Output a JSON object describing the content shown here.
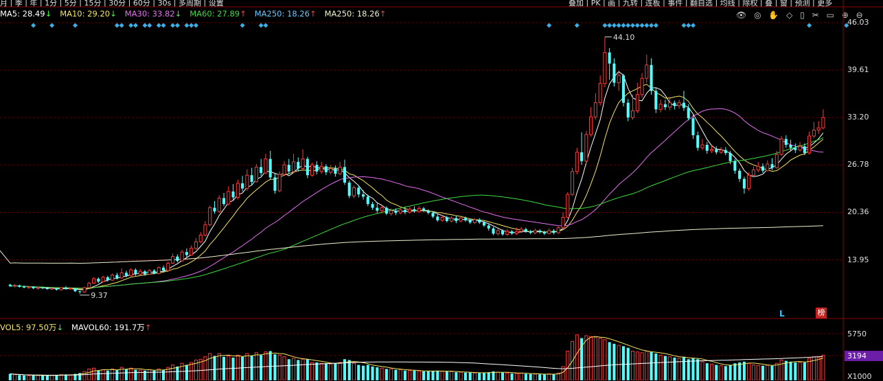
{
  "toolbar": {
    "left_items": [
      "月",
      "季",
      "年",
      "1分",
      "5分",
      "15分",
      "30分",
      "60分",
      "30s",
      "多周期",
      "设置"
    ],
    "right_items": [
      "叠加",
      "PK",
      "画",
      "九转",
      "连板",
      "事件",
      "翻自选",
      "均线",
      "除权",
      "叠",
      "窗",
      "预测",
      "更多"
    ]
  },
  "ma_legend": [
    {
      "label": "MA5: 28.49",
      "arrow": "↓",
      "color": "#ffffff"
    },
    {
      "label": "MA10: 29.20",
      "arrow": "↓",
      "color": "#f5e663"
    },
    {
      "label": "MA30: 33.82",
      "arrow": "↓",
      "color": "#e46ff0"
    },
    {
      "label": "MA60: 27.89",
      "arrow": "↑",
      "color": "#3ddc3d"
    },
    {
      "label": "MA250: 18.26",
      "arrow": "↑",
      "color": "#6cc6ff"
    },
    {
      "label": "MA250: 18.26",
      "arrow": "↑",
      "color": "#f0f0d0"
    }
  ],
  "vol_legend": [
    {
      "label": "VOL5: 97.50万",
      "arrow": "↓",
      "color": "#f5e663"
    },
    {
      "label": "MAVOL60: 191.7万",
      "arrow": "↑",
      "color": "#ffffff"
    }
  ],
  "annotations": {
    "high_label": "44.10",
    "low_label": "9.37",
    "marker_l": "L",
    "marker_bang": "榜"
  },
  "volume_axis": {
    "ticks": [
      "5750",
      "3194",
      "X1000"
    ]
  },
  "colors": {
    "up": "#ff3b3b",
    "down": "#54ffff",
    "grid": "#5a0000",
    "axis_text": "#e0e0e0"
  },
  "chart_data": {
    "type": "candlestick",
    "price_axis": {
      "ticks": [
        46.03,
        39.61,
        33.2,
        26.78,
        20.36,
        13.95
      ],
      "ylim": [
        7.5,
        46.03
      ]
    },
    "volume_axis": {
      "ylim": [
        0,
        5750
      ]
    },
    "candles": [
      [
        10.6,
        10.4,
        10.7,
        10.3,
        800
      ],
      [
        10.4,
        10.5,
        10.7,
        10.2,
        700
      ],
      [
        10.5,
        10.3,
        10.6,
        10.2,
        650
      ],
      [
        10.3,
        10.2,
        10.5,
        10.1,
        600
      ],
      [
        10.2,
        10.3,
        10.4,
        10.0,
        580
      ],
      [
        10.3,
        10.1,
        10.4,
        10.0,
        620
      ],
      [
        10.1,
        10.2,
        10.3,
        9.9,
        600
      ],
      [
        10.2,
        10.1,
        10.3,
        10.0,
        590
      ],
      [
        10.1,
        10.0,
        10.3,
        9.9,
        600
      ],
      [
        10.0,
        10.1,
        10.2,
        9.9,
        610
      ],
      [
        10.1,
        9.9,
        10.2,
        9.8,
        640
      ],
      [
        9.9,
        10.2,
        10.3,
        9.8,
        700
      ],
      [
        10.2,
        10.0,
        10.4,
        9.9,
        720
      ],
      [
        10.0,
        10.1,
        10.2,
        9.9,
        650
      ],
      [
        10.1,
        9.7,
        10.2,
        9.6,
        800
      ],
      [
        9.7,
        9.6,
        9.8,
        9.37,
        900
      ],
      [
        9.6,
        10.2,
        10.3,
        9.5,
        1100
      ],
      [
        10.2,
        10.8,
        11.0,
        10.1,
        1400
      ],
      [
        10.8,
        11.4,
        11.6,
        10.7,
        1500
      ],
      [
        11.4,
        11.0,
        11.6,
        10.8,
        1200
      ],
      [
        11.0,
        11.6,
        11.8,
        10.9,
        1300
      ],
      [
        11.6,
        11.2,
        11.8,
        11.0,
        1200
      ],
      [
        11.2,
        11.9,
        12.1,
        11.1,
        1400
      ],
      [
        11.9,
        11.5,
        12.2,
        11.3,
        1300
      ],
      [
        11.5,
        12.2,
        12.8,
        11.4,
        1600
      ],
      [
        12.2,
        11.8,
        12.5,
        11.6,
        1400
      ],
      [
        11.8,
        12.6,
        12.8,
        11.7,
        1500
      ],
      [
        12.6,
        12.0,
        12.8,
        11.8,
        1300
      ],
      [
        12.0,
        12.4,
        12.7,
        11.9,
        1250
      ],
      [
        12.4,
        12.0,
        12.6,
        11.8,
        1200
      ],
      [
        12.0,
        12.5,
        12.7,
        11.9,
        1300
      ],
      [
        12.5,
        12.1,
        12.7,
        12.0,
        1200
      ],
      [
        12.1,
        12.9,
        13.1,
        12.0,
        1400
      ],
      [
        12.9,
        12.5,
        13.2,
        12.3,
        1300
      ],
      [
        12.5,
        13.5,
        13.7,
        12.4,
        1600
      ],
      [
        13.5,
        14.4,
        14.8,
        13.4,
        1900
      ],
      [
        14.4,
        13.8,
        14.7,
        13.6,
        1700
      ],
      [
        13.8,
        15.0,
        15.3,
        13.7,
        2100
      ],
      [
        15.0,
        14.6,
        15.5,
        14.3,
        1900
      ],
      [
        14.6,
        15.5,
        15.9,
        14.5,
        2200
      ],
      [
        15.5,
        16.4,
        16.9,
        15.3,
        2500
      ],
      [
        16.4,
        17.3,
        17.7,
        16.2,
        2600
      ],
      [
        17.3,
        18.7,
        19.2,
        17.1,
        2900
      ],
      [
        18.7,
        21.0,
        21.3,
        18.5,
        3300
      ],
      [
        21.0,
        20.5,
        21.9,
        20.2,
        3000
      ],
      [
        20.5,
        22.3,
        22.7,
        20.3,
        3300
      ],
      [
        22.3,
        21.5,
        23.0,
        21.2,
        2900
      ],
      [
        21.5,
        23.2,
        23.9,
        21.3,
        3000
      ],
      [
        23.2,
        22.4,
        24.2,
        22.0,
        2800
      ],
      [
        22.4,
        24.3,
        24.8,
        22.1,
        3100
      ],
      [
        24.3,
        23.6,
        25.3,
        23.2,
        2900
      ],
      [
        23.6,
        25.4,
        26.2,
        23.3,
        3300
      ],
      [
        25.4,
        24.5,
        26.4,
        24.1,
        3000
      ],
      [
        24.5,
        26.5,
        26.9,
        24.4,
        3400
      ],
      [
        26.5,
        25.7,
        27.6,
        25.3,
        3100
      ],
      [
        25.7,
        27.6,
        28.3,
        25.5,
        3500
      ],
      [
        27.6,
        25.1,
        28.7,
        24.8,
        3600
      ],
      [
        25.1,
        23.3,
        25.6,
        22.9,
        3200
      ],
      [
        23.3,
        25.5,
        25.9,
        23.1,
        3100
      ],
      [
        25.5,
        26.8,
        27.3,
        25.3,
        2900
      ],
      [
        26.8,
        25.9,
        27.6,
        25.5,
        2600
      ],
      [
        25.9,
        27.2,
        28.3,
        25.7,
        2700
      ],
      [
        27.2,
        26.3,
        27.8,
        25.9,
        2500
      ],
      [
        26.3,
        27.6,
        28.9,
        26.1,
        2600
      ],
      [
        27.6,
        25.4,
        27.9,
        25.0,
        2600
      ],
      [
        25.4,
        26.8,
        27.1,
        25.2,
        2200
      ],
      [
        26.8,
        25.9,
        27.3,
        25.5,
        2200
      ],
      [
        25.9,
        26.6,
        27.2,
        25.6,
        2100
      ],
      [
        26.6,
        25.8,
        26.9,
        25.4,
        2100
      ],
      [
        25.8,
        26.3,
        26.8,
        25.5,
        2000
      ],
      [
        26.3,
        25.6,
        26.7,
        25.2,
        2100
      ],
      [
        25.6,
        26.5,
        27.2,
        25.4,
        2200
      ],
      [
        26.5,
        24.4,
        27.5,
        24.1,
        2600
      ],
      [
        24.4,
        22.6,
        24.7,
        22.3,
        2500
      ],
      [
        22.6,
        23.7,
        24.0,
        22.3,
        2100
      ],
      [
        23.7,
        22.8,
        24.0,
        22.4,
        1900
      ],
      [
        22.8,
        22.5,
        23.4,
        22.1,
        1800
      ],
      [
        22.5,
        21.5,
        22.8,
        21.2,
        1900
      ],
      [
        21.5,
        21.0,
        21.8,
        20.7,
        1700
      ],
      [
        21.0,
        20.6,
        21.6,
        20.3,
        1600
      ],
      [
        20.6,
        21.0,
        21.3,
        20.2,
        1500
      ],
      [
        21.0,
        20.2,
        21.2,
        20.0,
        1400
      ],
      [
        20.2,
        20.6,
        20.9,
        19.9,
        1400
      ],
      [
        20.6,
        20.3,
        20.9,
        20.0,
        1300
      ],
      [
        20.3,
        20.7,
        21.0,
        20.1,
        1300
      ],
      [
        20.7,
        20.4,
        21.1,
        20.1,
        1200
      ],
      [
        20.4,
        20.8,
        21.1,
        20.2,
        1200
      ],
      [
        20.8,
        20.5,
        21.2,
        20.3,
        1200
      ],
      [
        20.5,
        20.9,
        21.2,
        20.3,
        1150
      ],
      [
        20.9,
        20.6,
        21.1,
        20.4,
        1100
      ],
      [
        20.6,
        20.3,
        20.8,
        20.1,
        1100
      ],
      [
        20.3,
        19.8,
        20.5,
        19.6,
        1150
      ],
      [
        19.8,
        19.3,
        20.1,
        19.1,
        1200
      ],
      [
        19.3,
        19.7,
        20.0,
        19.1,
        1100
      ],
      [
        19.7,
        19.2,
        19.9,
        19.0,
        1100
      ],
      [
        19.2,
        19.6,
        19.9,
        19.0,
        1050
      ],
      [
        19.6,
        19.2,
        19.9,
        18.9,
        1000
      ],
      [
        19.2,
        19.6,
        19.9,
        19.0,
        1000
      ],
      [
        19.6,
        19.3,
        19.8,
        19.1,
        950
      ],
      [
        19.3,
        19.0,
        19.5,
        18.8,
        950
      ],
      [
        19.0,
        19.4,
        19.6,
        18.8,
        900
      ],
      [
        19.4,
        19.0,
        19.6,
        18.8,
        900
      ],
      [
        19.0,
        18.6,
        19.2,
        18.4,
        950
      ],
      [
        18.6,
        18.2,
        18.9,
        17.9,
        1000
      ],
      [
        18.2,
        17.5,
        18.4,
        17.3,
        1100
      ],
      [
        17.5,
        17.9,
        18.2,
        17.2,
        1000
      ],
      [
        17.9,
        17.4,
        18.1,
        17.2,
        950
      ],
      [
        17.4,
        17.8,
        18.1,
        17.2,
        900
      ],
      [
        17.8,
        17.5,
        18.0,
        17.3,
        850
      ],
      [
        17.5,
        17.8,
        18.3,
        17.3,
        850
      ],
      [
        17.8,
        18.1,
        18.4,
        17.6,
        900
      ],
      [
        18.1,
        17.8,
        18.3,
        17.6,
        800
      ],
      [
        17.8,
        17.6,
        18.0,
        17.4,
        780
      ],
      [
        17.6,
        17.9,
        18.2,
        17.4,
        760
      ],
      [
        17.9,
        17.7,
        18.1,
        17.5,
        740
      ],
      [
        17.7,
        17.5,
        17.9,
        17.3,
        740
      ],
      [
        17.5,
        17.9,
        18.2,
        17.4,
        800
      ],
      [
        17.9,
        17.6,
        18.1,
        17.4,
        760
      ],
      [
        17.6,
        18.3,
        18.5,
        17.5,
        900
      ],
      [
        18.3,
        19.7,
        20.4,
        18.2,
        1700
      ],
      [
        19.7,
        22.8,
        23.1,
        19.6,
        3600
      ],
      [
        22.8,
        25.9,
        26.4,
        22.6,
        4800
      ],
      [
        25.9,
        28.5,
        29.1,
        25.5,
        5600
      ],
      [
        28.5,
        27.3,
        31.2,
        26.8,
        5200
      ],
      [
        27.3,
        30.9,
        31.4,
        27.0,
        5500
      ],
      [
        30.9,
        33.3,
        34.6,
        30.6,
        5400
      ],
      [
        33.3,
        35.2,
        36.5,
        32.9,
        5300
      ],
      [
        35.2,
        37.8,
        38.9,
        34.8,
        5200
      ],
      [
        37.8,
        42.0,
        44.1,
        37.3,
        5000
      ],
      [
        42.0,
        40.5,
        42.6,
        38.3,
        4700
      ],
      [
        40.5,
        37.9,
        41.2,
        37.4,
        4500
      ],
      [
        37.9,
        38.9,
        39.4,
        36.8,
        4300
      ],
      [
        38.9,
        35.2,
        39.1,
        34.7,
        4200
      ],
      [
        35.2,
        33.2,
        35.7,
        32.7,
        4000
      ],
      [
        33.2,
        34.1,
        36.3,
        32.9,
        3600
      ],
      [
        34.1,
        36.3,
        37.9,
        33.8,
        3500
      ],
      [
        36.3,
        38.5,
        39.2,
        35.9,
        3400
      ],
      [
        38.5,
        40.3,
        41.7,
        37.9,
        3600
      ],
      [
        40.3,
        36.8,
        41.2,
        36.3,
        3500
      ],
      [
        36.8,
        34.3,
        37.2,
        33.8,
        3300
      ],
      [
        34.3,
        35.0,
        35.6,
        33.9,
        3100
      ],
      [
        35.0,
        34.6,
        35.6,
        34.2,
        3000
      ],
      [
        34.6,
        35.2,
        36.0,
        34.2,
        2900
      ],
      [
        35.2,
        34.8,
        35.5,
        34.3,
        2800
      ],
      [
        34.8,
        35.2,
        35.6,
        34.4,
        2700
      ],
      [
        35.2,
        34.5,
        36.8,
        34.1,
        2900
      ],
      [
        34.5,
        33.1,
        35.0,
        32.8,
        2600
      ],
      [
        33.1,
        30.8,
        33.6,
        30.3,
        2700
      ],
      [
        30.8,
        29.1,
        31.3,
        28.7,
        2600
      ],
      [
        29.1,
        29.5,
        30.3,
        28.8,
        2300
      ],
      [
        29.5,
        28.7,
        29.9,
        28.3,
        2100
      ],
      [
        28.7,
        28.9,
        29.4,
        28.4,
        2000
      ],
      [
        28.9,
        28.5,
        29.3,
        28.2,
        1900
      ],
      [
        28.5,
        28.8,
        29.2,
        28.3,
        1800
      ],
      [
        28.8,
        28.4,
        29.2,
        28.1,
        1750
      ],
      [
        28.4,
        27.3,
        28.7,
        26.9,
        1900
      ],
      [
        27.3,
        26.0,
        27.6,
        25.6,
        2100
      ],
      [
        26.0,
        24.9,
        26.3,
        24.5,
        2200
      ],
      [
        24.9,
        23.6,
        25.2,
        22.9,
        2300
      ],
      [
        23.6,
        25.4,
        25.8,
        23.3,
        2100
      ],
      [
        25.4,
        26.1,
        26.6,
        25.1,
        1900
      ],
      [
        26.1,
        26.6,
        27.2,
        25.8,
        1850
      ],
      [
        26.6,
        26.0,
        27.0,
        25.7,
        1800
      ],
      [
        26.0,
        26.9,
        27.4,
        25.9,
        1850
      ],
      [
        26.9,
        26.4,
        27.7,
        26.1,
        1800
      ],
      [
        26.4,
        28.2,
        28.7,
        26.3,
        2100
      ],
      [
        28.2,
        30.3,
        30.7,
        28.0,
        2500
      ],
      [
        30.3,
        29.5,
        30.8,
        29.1,
        2400
      ],
      [
        29.5,
        29.1,
        30.2,
        28.7,
        2300
      ],
      [
        29.1,
        28.8,
        29.7,
        28.4,
        2200
      ],
      [
        28.8,
        29.3,
        29.9,
        28.6,
        2200
      ],
      [
        29.3,
        28.4,
        29.7,
        28.1,
        2200
      ],
      [
        28.4,
        30.7,
        31.3,
        28.2,
        2700
      ],
      [
        30.7,
        31.5,
        32.6,
        30.4,
        2900
      ],
      [
        31.5,
        31.8,
        32.7,
        31.0,
        2800
      ],
      [
        31.8,
        33.2,
        34.3,
        31.6,
        3100
      ]
    ],
    "moving_averages": [
      "MA5",
      "MA10",
      "MA30",
      "MA60",
      "MA250"
    ],
    "signal_markers_top": [
      5,
      9,
      14,
      23,
      24,
      26,
      27,
      29,
      30,
      32,
      33,
      35,
      36,
      38,
      39,
      40,
      50,
      54,
      55,
      116,
      122,
      128,
      129,
      130,
      131,
      132,
      133,
      134,
      135,
      136,
      137,
      138,
      139,
      145,
      146,
      147,
      172,
      180
    ]
  }
}
